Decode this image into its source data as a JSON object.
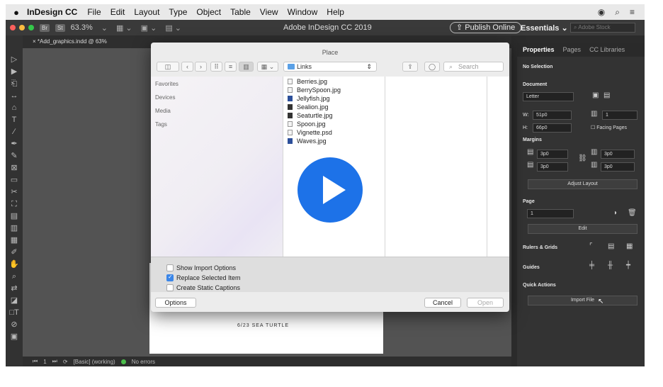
{
  "menubar": {
    "apple": "",
    "app_name": "InDesign CC",
    "items": [
      "File",
      "Edit",
      "Layout",
      "Type",
      "Object",
      "Table",
      "View",
      "Window",
      "Help"
    ]
  },
  "appbar": {
    "br": "Br",
    "st": "St",
    "zoom": "63.3%",
    "window_title": "Adobe InDesign CC 2019",
    "publish": "Publish Online",
    "workspace": "Essentials ⌄",
    "stock_placeholder": "Adobe Stock"
  },
  "document": {
    "tab": "× *Add_graphics.indd @ 63%",
    "page_heading": "6/23 SEA TURTLE"
  },
  "statusbar": {
    "page": "1",
    "style": "[Basic] (working)",
    "errors": "No errors"
  },
  "panel": {
    "tabs": [
      "Properties",
      "Pages",
      "CC Libraries"
    ],
    "no_selection": "No Selection",
    "document": "Document",
    "size": "Letter",
    "w_label": "W:",
    "w_value": "51p0",
    "h_label": "H:",
    "h_value": "66p0",
    "pages_count": "1",
    "facing": "Facing Pages",
    "margins": "Margins",
    "margin_top": "3p0",
    "margin_bottom": "3p0",
    "margin_left": "3p0",
    "margin_right": "3p0",
    "adjust": "Adjust Layout",
    "page": "Page",
    "page_value": "1",
    "edit": "Edit",
    "rulers": "Rulers & Grids",
    "guides": "Guides",
    "quick": "Quick Actions",
    "import": "Import File"
  },
  "dialog": {
    "title": "Place",
    "folder": "Links",
    "search_placeholder": "Search",
    "sidebar": [
      "Favorites",
      "Devices",
      "Media",
      "Tags"
    ],
    "files": [
      {
        "name": "Berries.jpg",
        "icon": "doc-icon"
      },
      {
        "name": "BerrySpoon.jpg",
        "icon": "doc-icon"
      },
      {
        "name": "Jellyfish.jpg",
        "icon": "image-icon"
      },
      {
        "name": "Sealion.jpg",
        "icon": "image-icon"
      },
      {
        "name": "Seaturtle.jpg",
        "icon": "image-icon"
      },
      {
        "name": "Spoon.jpg",
        "icon": "doc-icon"
      },
      {
        "name": "Vignette.psd",
        "icon": "doc-icon"
      },
      {
        "name": "Waves.jpg",
        "icon": "image-icon"
      }
    ],
    "options": [
      {
        "label": "Show Import Options",
        "checked": false
      },
      {
        "label": "Replace Selected Item",
        "checked": true
      },
      {
        "label": "Create Static Captions",
        "checked": false
      }
    ],
    "btn_options": "Options",
    "btn_cancel": "Cancel",
    "btn_open": "Open"
  },
  "colors": {
    "accent": "#1d72e8",
    "frame": "#2b2b2b",
    "dialog": "#ececec"
  }
}
